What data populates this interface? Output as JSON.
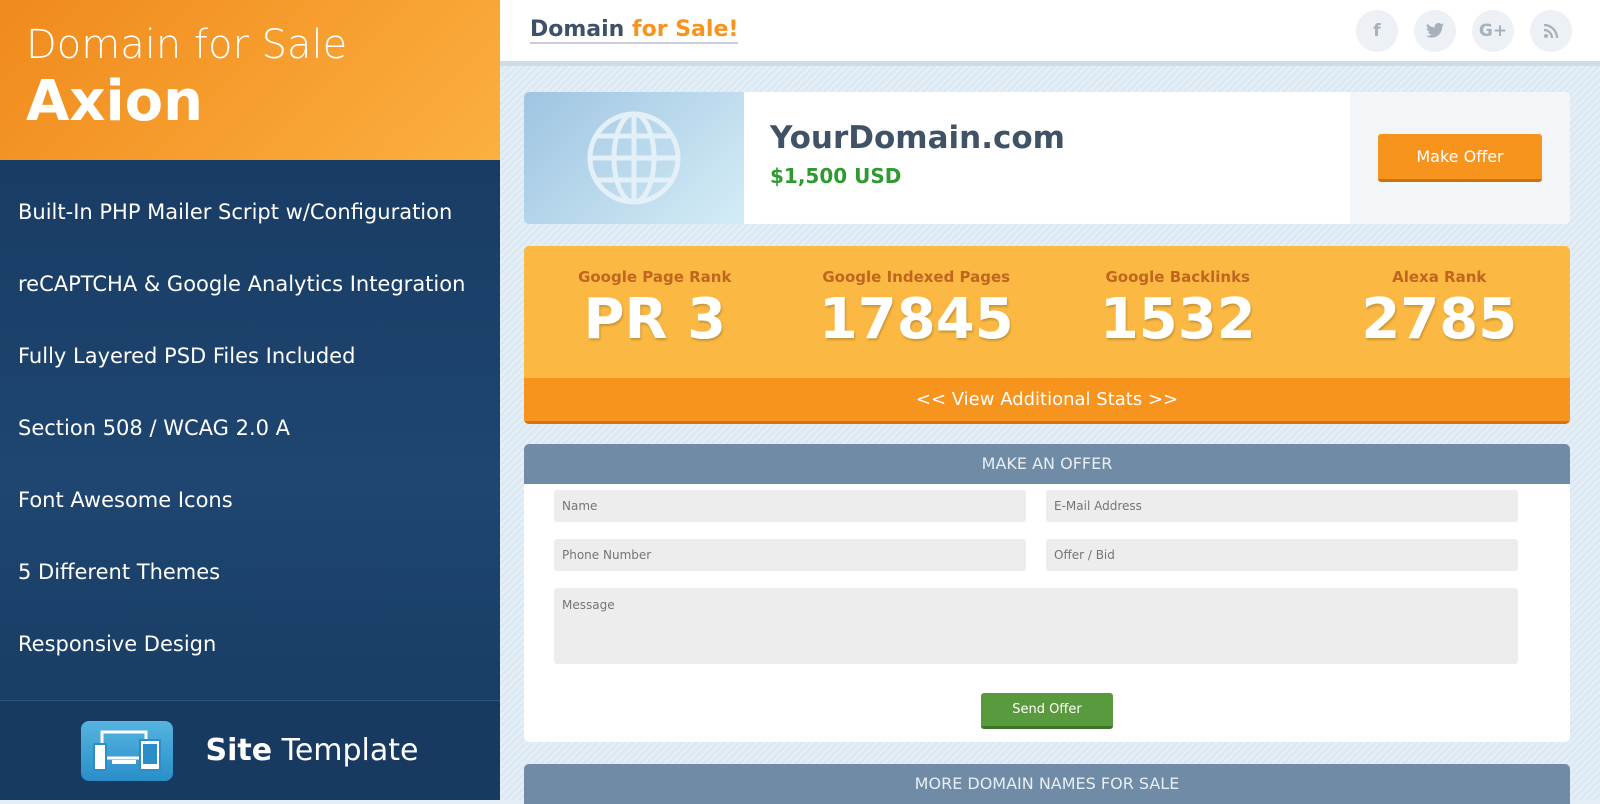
{
  "sidebar": {
    "title_line1": "Domain for Sale",
    "title_line2": "Axion",
    "features": [
      "Built-In PHP Mailer Script w/Configuration",
      "reCAPTCHA & Google Analytics Integration",
      "Fully Layered PSD Files Included",
      "Section 508 / WCAG 2.0 A",
      "Font Awesome Icons",
      "5 Different Themes",
      "Responsive Design"
    ],
    "footer": {
      "bold": "Site",
      "rest": " Template"
    }
  },
  "header": {
    "logo_part1": "Domain ",
    "logo_part2": "for Sale!",
    "social": [
      {
        "icon": "facebook-icon",
        "glyph": "f"
      },
      {
        "icon": "twitter-icon",
        "glyph": "t"
      },
      {
        "icon": "google-plus-icon",
        "glyph": "G+"
      },
      {
        "icon": "rss-icon",
        "glyph": "))"
      }
    ]
  },
  "domain": {
    "name": "YourDomain.com",
    "price": "$1,500 USD",
    "make_offer": "Make Offer"
  },
  "stats": {
    "items": [
      {
        "label": "Google Page Rank",
        "value": "PR 3"
      },
      {
        "label": "Google Indexed Pages",
        "value": "17845"
      },
      {
        "label": "Google Backlinks",
        "value": "1532"
      },
      {
        "label": "Alexa Rank",
        "value": "2785"
      }
    ],
    "more": "<< View Additional Stats >>"
  },
  "offer_form": {
    "title": "MAKE AN OFFER",
    "name": "Name",
    "email": "E-Mail Address",
    "phone": "Phone Number",
    "bid": "Offer / Bid",
    "message": "Message",
    "send": "Send Offer"
  },
  "more_domains": {
    "title": "MORE DOMAIN NAMES FOR SALE"
  },
  "colors": {
    "accent": "#f7941d",
    "navy": "#1e4670",
    "green": "#5a9a3e"
  }
}
